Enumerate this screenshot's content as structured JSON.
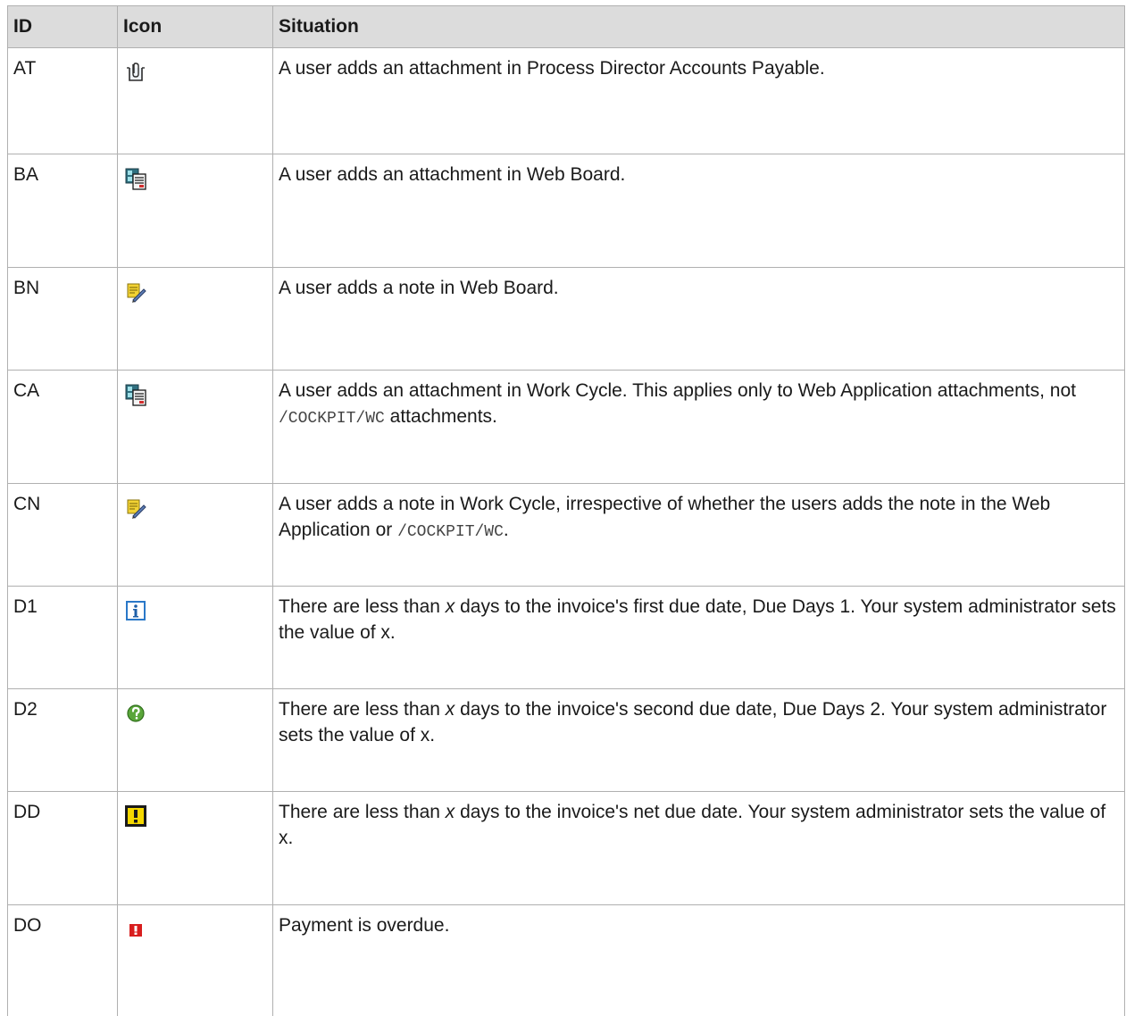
{
  "header": {
    "id": "ID",
    "icon": "Icon",
    "situation": "Situation"
  },
  "rows": [
    {
      "id": "AT",
      "icon": "attachment-clip-icon",
      "situation": "A user adds an attachment in Process Director Accounts Payable."
    },
    {
      "id": "BA",
      "icon": "web-attachment-icon",
      "situation": "A user adds an attachment in Web Board."
    },
    {
      "id": "BN",
      "icon": "note-pencil-icon",
      "situation": "A user adds a note in Web Board."
    },
    {
      "id": "CA",
      "icon": "web-attachment-icon",
      "situation_a": "A user adds an attachment in Work Cycle. This applies only to Web Application attachments, not ",
      "situation_code": "/COCKPIT/WC",
      "situation_b": " attachments."
    },
    {
      "id": "CN",
      "icon": "note-pencil-icon",
      "situation_a": "A user adds a note in Work Cycle, irrespective of whether the users adds the note in the Web Application or ",
      "situation_code": "/COCKPIT/WC",
      "situation_b": "."
    },
    {
      "id": "D1",
      "icon": "info-icon",
      "situation_a": "There are less than ",
      "situation_x": "x",
      "situation_b": " days to the invoice's first due date, Due Days 1. Your system administrator sets the value of x."
    },
    {
      "id": "D2",
      "icon": "question-icon",
      "situation_a": "There are less than ",
      "situation_x": "x",
      "situation_b": " days to the invoice's second due date, Due Days 2. Your system administrator sets the value of x."
    },
    {
      "id": "DD",
      "icon": "warning-exclamation-icon",
      "situation_a": "There are less than ",
      "situation_x": "x",
      "situation_b": " days to the invoice's net due date. Your system administrator sets the value of x."
    },
    {
      "id": "DO",
      "icon": "overdue-exclamation-icon",
      "situation": "Payment is overdue."
    }
  ]
}
